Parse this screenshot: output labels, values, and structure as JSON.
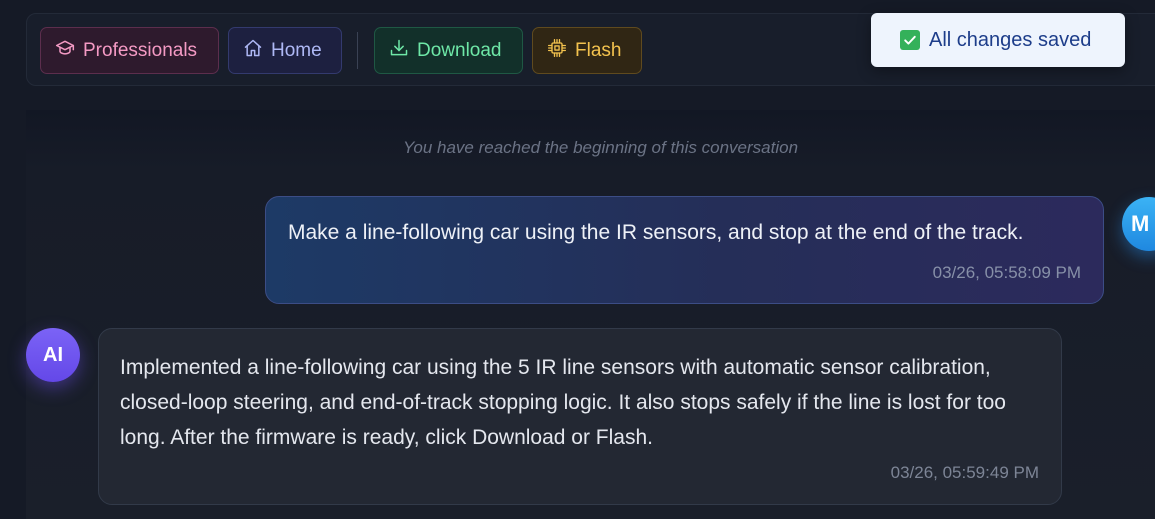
{
  "toolbar": {
    "buttons": [
      {
        "label": "Professionals",
        "icon": "graduation-cap-icon",
        "color": "#f49ac4"
      },
      {
        "label": "Home",
        "icon": "home-icon",
        "color": "#aeb8f5"
      },
      {
        "label": "Download",
        "icon": "download-icon",
        "color": "#6ee7a7"
      },
      {
        "label": "Flash",
        "icon": "chip-icon",
        "color": "#f3c24e"
      }
    ]
  },
  "toast": {
    "text": "All changes saved",
    "icon": "checkbox-check-icon"
  },
  "chat": {
    "beginning_notice": "You have reached the beginning of this conversation",
    "messages": [
      {
        "role": "user",
        "avatar": "M",
        "text": "Make a line-following car using the IR sensors, and stop at the end of the track.",
        "time": "03/26, 05:58:09 PM"
      },
      {
        "role": "assistant",
        "avatar": "AI",
        "text": "Implemented a line-following car using the 5 IR line sensors with automatic sensor calibration, closed-loop steering, and end-of-track stopping logic. It also stops safely if the line is lost for too long. After the firmware is ready, click Download or Flash.",
        "time": "03/26, 05:59:49 PM"
      }
    ]
  }
}
